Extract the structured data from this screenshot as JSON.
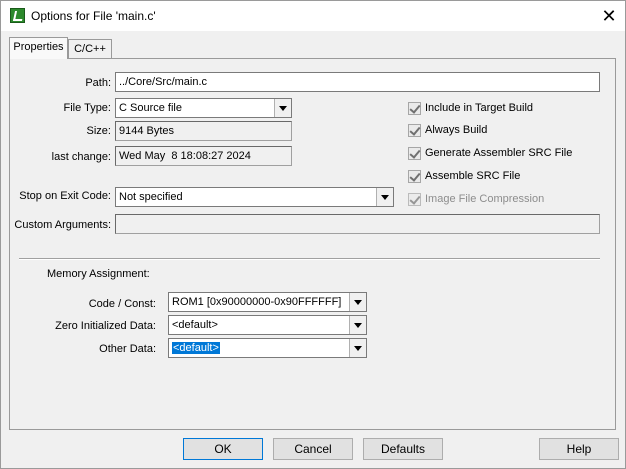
{
  "window": {
    "title": "Options for File 'main.c'",
    "close_glyph": "✕"
  },
  "tabs": [
    {
      "label": "Properties"
    },
    {
      "label": "C/C++"
    }
  ],
  "properties": {
    "path_label": "Path:",
    "path_value": "../Core/Src/main.c",
    "file_type_label": "File Type:",
    "file_type_value": "C Source file",
    "size_label": "Size:",
    "size_value": "9144 Bytes",
    "last_change_label": "last change:",
    "last_change_value": "Wed May  8 18:08:27 2024",
    "stop_label": "Stop on Exit Code:",
    "stop_value": "Not specified",
    "custom_args_label": "Custom Arguments:",
    "custom_args_value": ""
  },
  "checkboxes": [
    {
      "label": "Include in Target Build",
      "checked": true,
      "enabled": true
    },
    {
      "label": "Always Build",
      "checked": true,
      "enabled": true
    },
    {
      "label": "Generate Assembler SRC File",
      "checked": true,
      "enabled": true
    },
    {
      "label": "Assemble SRC File",
      "checked": true,
      "enabled": true
    },
    {
      "label": "Image File Compression",
      "checked": true,
      "enabled": false
    }
  ],
  "memory": {
    "heading": "Memory Assignment:",
    "code_label": "Code / Const:",
    "code_value": "ROM1 [0x90000000-0x90FFFFFF]",
    "zero_label": "Zero Initialized Data:",
    "zero_value": "<default>",
    "other_label": "Other Data:",
    "other_value": "<default>"
  },
  "buttons": {
    "ok": "OK",
    "cancel": "Cancel",
    "defaults": "Defaults",
    "help": "Help"
  }
}
